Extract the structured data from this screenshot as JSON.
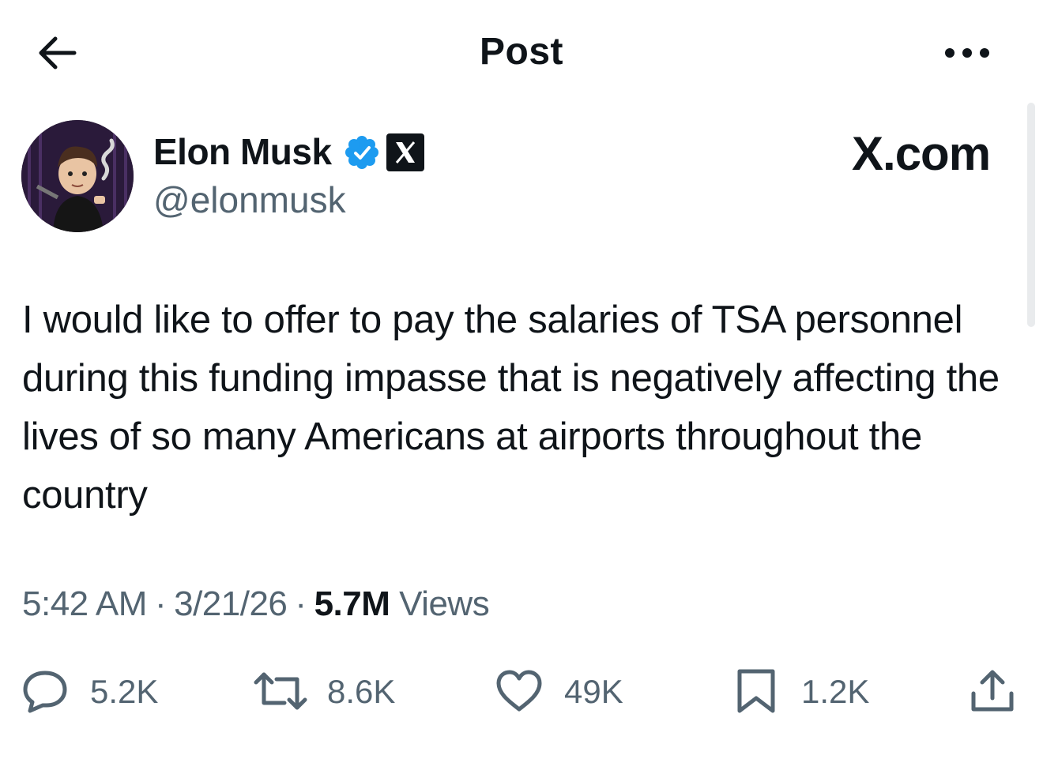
{
  "header": {
    "title": "Post",
    "back_icon": "arrow-left-icon",
    "more_icon": "ellipsis-icon"
  },
  "author": {
    "display_name": "Elon Musk",
    "handle": "@elonmusk",
    "verified_icon": "verified-badge-icon",
    "affiliation_icon": "x-logo-icon",
    "brand_text": "X.com"
  },
  "post": {
    "text": "I would like to offer to pay the salaries of TSA personnel during this funding impasse that is negatively affecting the lives of so many Americans at airports throughout the country"
  },
  "meta": {
    "time": "5:42 AM",
    "separator": "·",
    "date": "3/21/26",
    "views_count": "5.7M",
    "views_label": "Views"
  },
  "actions": {
    "replies": "5.2K",
    "reposts": "8.6K",
    "likes": "49K",
    "bookmarks": "1.2K"
  },
  "colors": {
    "text": "#0f1419",
    "secondary": "#536471",
    "verified": "#1d9bf0",
    "background": "#ffffff"
  }
}
